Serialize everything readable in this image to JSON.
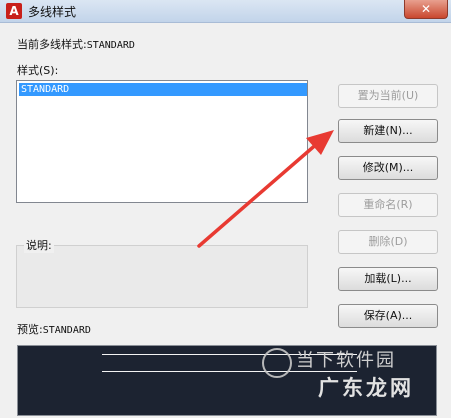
{
  "window": {
    "title": "多线样式",
    "close_glyph": "✕"
  },
  "current_style": {
    "label": "当前多线样式:",
    "value": "STANDARD"
  },
  "styles": {
    "label": "样式(S):",
    "items": [
      "STANDARD"
    ]
  },
  "description": {
    "label": "说明:"
  },
  "preview": {
    "label": "预览:",
    "value": "STANDARD"
  },
  "buttons": [
    {
      "label": "置为当前(U)",
      "enabled": false
    },
    {
      "label": "新建(N)...",
      "enabled": true
    },
    {
      "label": "修改(M)...",
      "enabled": true
    },
    {
      "label": "重命名(R)",
      "enabled": false
    },
    {
      "label": "删除(D)",
      "enabled": false
    },
    {
      "label": "加载(L)...",
      "enabled": true
    },
    {
      "label": "保存(A)...",
      "enabled": true
    }
  ],
  "watermark": {
    "line1": "当下软件园",
    "line2": "广东龙网"
  },
  "annotation": {
    "color": "#e83a32",
    "target": "新建(N)..."
  }
}
